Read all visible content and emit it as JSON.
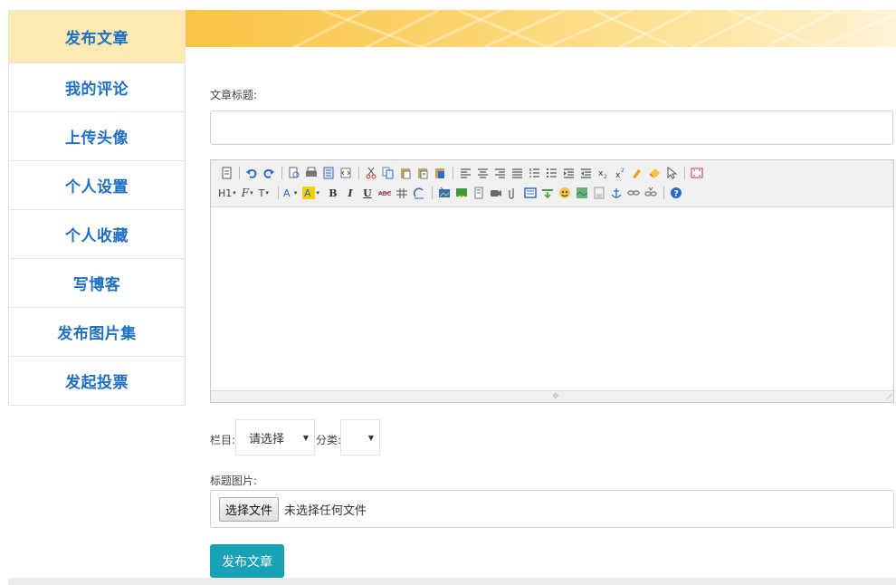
{
  "sidebar": {
    "items": [
      {
        "label": "发布文章",
        "active": true
      },
      {
        "label": "我的评论"
      },
      {
        "label": "上传头像"
      },
      {
        "label": "个人设置"
      },
      {
        "label": "个人收藏"
      },
      {
        "label": "写博客"
      },
      {
        "label": "发布图片集"
      },
      {
        "label": "发起投票"
      }
    ]
  },
  "form": {
    "title_label": "文章标题:",
    "title_value": "",
    "column_label": "栏目:",
    "column_selected": "请选择",
    "category_label": "分类:",
    "category_selected": "",
    "image_label": "标题图片:",
    "file_button": "选择文件",
    "file_status": "未选择任何文件",
    "submit_label": "发布文章"
  },
  "editor": {
    "heading_dropdown": "H1",
    "font_dropdown": "F",
    "size_dropdown": "T",
    "bold": "B",
    "italic": "I",
    "underline": "U"
  },
  "colors": {
    "accent_blue": "#1f6fc5",
    "active_item_bg": "#fde9b2",
    "submit_bg": "#17a2b8"
  }
}
